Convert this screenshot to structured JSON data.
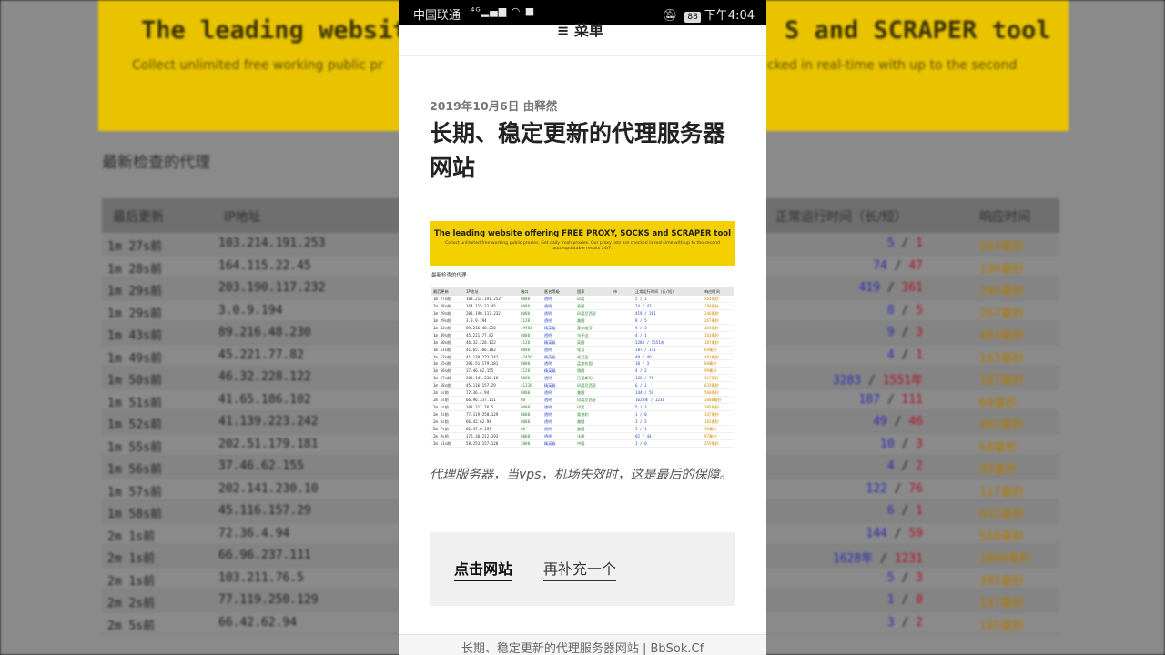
{
  "background": {
    "banner_title_left": "The leading website",
    "banner_title_right": "S and SCRAPER tool",
    "banner_sub_left": "Collect unlimited free working public pr",
    "banner_sub_right": "cked in real-time with up to the second",
    "heading": "最新检查的代理",
    "headers": [
      "最后更新",
      "IP地址",
      "正常运行时间（长/短）",
      "响应时间"
    ],
    "rows": [
      {
        "t": "1m 27s前",
        "ip": "103.214.191.253",
        "a": "5",
        "b": "1",
        "ms": "564毫秒"
      },
      {
        "t": "1m 28s前",
        "ip": "164.115.22.45",
        "a": "74",
        "b": "47",
        "ms": "190毫秒"
      },
      {
        "t": "1m 29s前",
        "ip": "203.190.117.232",
        "a": "419",
        "b": "361",
        "ms": "246毫秒"
      },
      {
        "t": "1m 29s前",
        "ip": "3.0.9.194",
        "a": "8",
        "b": "5",
        "ms": "267毫秒"
      },
      {
        "t": "1m 43s前",
        "ip": "89.216.48.230",
        "a": "9",
        "b": "3",
        "ms": "484毫秒"
      },
      {
        "t": "1m 49s前",
        "ip": "45.221.77.82",
        "a": "4",
        "b": "1",
        "ms": "163毫秒"
      },
      {
        "t": "1m 50s前",
        "ip": "46.32.228.122",
        "a": "3283",
        "b": "1551年",
        "ms": "187毫秒"
      },
      {
        "t": "1m 51s前",
        "ip": "41.65.186.102",
        "a": "187",
        "b": "111",
        "ms": "69毫秒"
      },
      {
        "t": "1m 52s前",
        "ip": "41.139.223.242",
        "a": "49",
        "b": "46",
        "ms": "482毫秒"
      },
      {
        "t": "1m 55s前",
        "ip": "202.51.179.181",
        "a": "10",
        "b": "3",
        "ms": "68毫秒"
      },
      {
        "t": "1m 56s前",
        "ip": "37.46.62.155",
        "a": "4",
        "b": "2",
        "ms": "99毫秒"
      },
      {
        "t": "1m 57s前",
        "ip": "202.141.230.10",
        "a": "122",
        "b": "76",
        "ms": "117毫秒"
      },
      {
        "t": "1m 58s前",
        "ip": "45.116.157.29",
        "a": "6",
        "b": "1",
        "ms": "632毫秒"
      },
      {
        "t": "2m 1s前",
        "ip": "72.36.4.94",
        "a": "144",
        "b": "59",
        "ms": "560毫秒"
      },
      {
        "t": "2m 1s前",
        "ip": "66.96.237.111",
        "a": "1628年",
        "b": "1231",
        "ms": "1000毫秒"
      },
      {
        "t": "2m 1s前",
        "ip": "103.211.76.5",
        "a": "5",
        "b": "3",
        "ms": "395毫秒"
      },
      {
        "t": "2m 2s前",
        "ip": "77.119.250.129",
        "a": "1",
        "b": "0",
        "ms": "147毫秒"
      },
      {
        "t": "2m 5s前",
        "ip": "66.42.62.94",
        "a": "3",
        "b": "2",
        "ms": "165毫秒"
      }
    ]
  },
  "status_bar": {
    "carrier": "中国联通",
    "battery": "88",
    "time": "下午4:04"
  },
  "nav": {
    "menu_label": "≡ 菜单"
  },
  "article": {
    "meta": "2019年10月6日 由释然",
    "title": "长期、稳定更新的代理服务器网站",
    "image": {
      "banner_title": "The leading website offering FREE PROXY, SOCKS and SCRAPER tool",
      "banner_sub": "Collect unlimited free working public proxies. Get daily fresh proxies. Our proxy lists are checked in real-time with up to the second auto-updatable results 24/7.",
      "heading": "最新检查的代理",
      "headers": [
        "最后更新",
        "IP地址",
        "端口",
        "匿名等级",
        "国家",
        "市",
        "正常运行时间（长/短）",
        "响应时间"
      ],
      "rows": [
        [
          "1m 27s前",
          "103.214.191.253",
          "8080",
          "透明",
          "印度",
          "",
          "5 / 1",
          "564毫秒"
        ],
        [
          "1m 28s前",
          "164.115.22.45",
          "8080",
          "透明",
          "泰国",
          "",
          "74 / 47",
          "190毫秒"
        ],
        [
          "1m 29s前",
          "203.190.117.232",
          "8080",
          "透明",
          "印度尼西亚",
          "",
          "419 / 361",
          "246毫秒"
        ],
        [
          "1m 29s前",
          "3.0.9.194",
          "3128",
          "透明",
          "美国",
          "",
          "8 / 5",
          "267毫秒"
        ],
        [
          "1m 43s前",
          "89.216.48.230",
          "49981",
          "精英级",
          "塞尔维亚",
          "",
          "9 / 3",
          "484毫秒"
        ],
        [
          "1m 49s前",
          "45.221.77.82",
          "8080",
          "透明",
          "乌干达",
          "",
          "4 / 1",
          "163毫秒"
        ],
        [
          "1m 50s前",
          "46.32.228.122",
          "3128",
          "精英级",
          "英国",
          "",
          "3283 / 1551年",
          "187毫秒"
        ],
        [
          "1m 51s前",
          "41.65.186.102",
          "8080",
          "透明",
          "埃及",
          "",
          "187 / 111",
          "69毫秒"
        ],
        [
          "1m 52s前",
          "41.139.223.242",
          "47456",
          "精英级",
          "肯尼亚",
          "",
          "49 / 46",
          "482毫秒"
        ],
        [
          "1m 55s前",
          "202.51.179.181",
          "8080",
          "透明",
          "孟加拉国",
          "",
          "10 / 3",
          "68毫秒"
        ],
        [
          "1m 56s前",
          "37.46.62.155",
          "3128",
          "精英级",
          "俄国",
          "",
          "4 / 2",
          "99毫秒"
        ],
        [
          "1m 57s前",
          "202.141.230.10",
          "8080",
          "透明",
          "巴基斯坦",
          "",
          "122 / 76",
          "117毫秒"
        ],
        [
          "1m 58s前",
          "45.116.157.29",
          "41336",
          "精英级",
          "印度尼西亚",
          "",
          "6 / 1",
          "632毫秒"
        ],
        [
          "2m 1s前",
          "72.36.4.94",
          "8080",
          "透明",
          "美国",
          "",
          "144 / 59",
          "560毫秒"
        ],
        [
          "2m 1s前",
          "66.96.237.111",
          "80",
          "透明",
          "印度尼西亚",
          "",
          "1628年 / 1231",
          "1000毫秒"
        ],
        [
          "2m 1s前",
          "103.211.76.5",
          "8080",
          "透明",
          "印度",
          "",
          "5 / 3",
          "395毫秒"
        ],
        [
          "2m 2s前",
          "77.119.250.129",
          "8080",
          "透明",
          "奥地利",
          "",
          "1 / 0",
          "147毫秒"
        ],
        [
          "2m 5s前",
          "66.42.62.94",
          "8080",
          "透明",
          "美国",
          "",
          "3 / 2",
          "165毫秒"
        ],
        [
          "2m 7s前",
          "62.47.0.197",
          "80",
          "透明",
          "美国",
          "",
          "5 / 1",
          "56毫秒"
        ],
        [
          "2m 9s前",
          "176.30.212.193",
          "8080",
          "透明",
          "法国",
          "",
          "82 / 44",
          "97毫秒"
        ],
        [
          "2m 11s前",
          "58.253.157.120",
          "3000",
          "精英级",
          "中国",
          "",
          "3 / 0",
          "259毫秒"
        ]
      ]
    },
    "caption": "代理服务器，当vps，机场失效时，这是最后的保障。",
    "link_primary": "点击网站",
    "link_secondary": "再补充一个"
  },
  "bottom_bar": {
    "title": "长期、稳定更新的代理服务器网站 | BbSok.Cf"
  }
}
